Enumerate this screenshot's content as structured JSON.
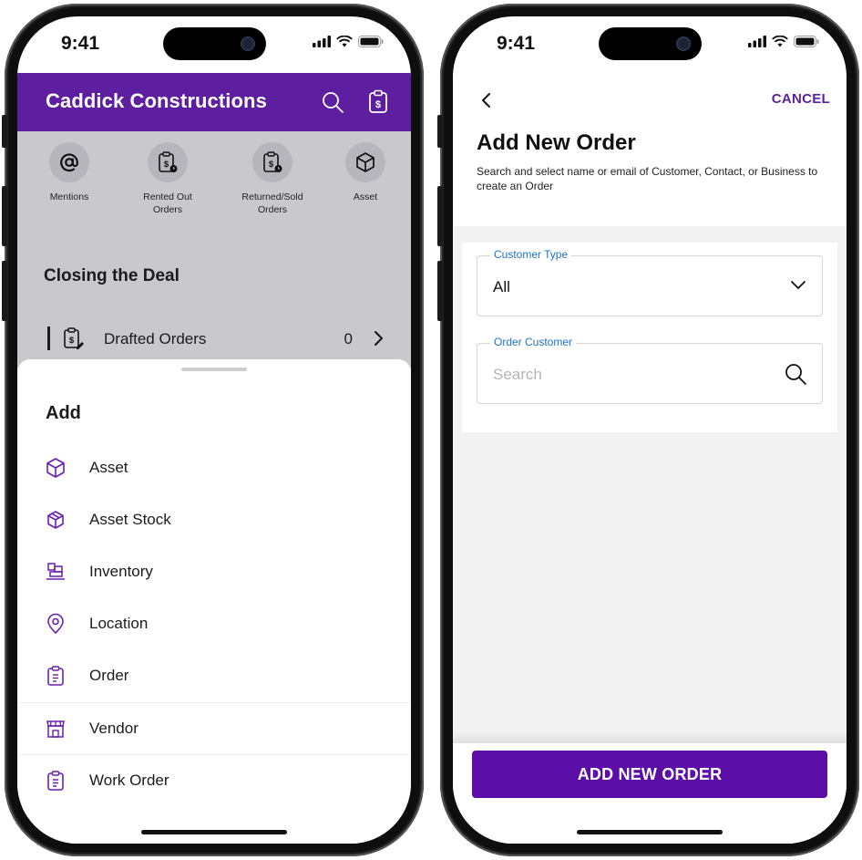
{
  "left": {
    "status": {
      "time": "9:41"
    },
    "header": {
      "title": "Caddick Constructions",
      "search_icon": "search-icon",
      "order_icon": "clipboard-dollar-icon",
      "bg_color": "#5e1ea0"
    },
    "shortcuts": [
      {
        "label_line1": "Mentions",
        "label_line2": "",
        "icon": "at-sign-icon"
      },
      {
        "label_line1": "Rented Out",
        "label_line2": "Orders",
        "icon": "clipboard-dollar-clock-icon"
      },
      {
        "label_line1": "Returned/Sold",
        "label_line2": "Orders",
        "icon": "clipboard-dollar-clock-icon"
      },
      {
        "label_line1": "Asset",
        "label_line2": "",
        "icon": "cube-icon"
      }
    ],
    "section_title": "Closing the Deal",
    "drafted": {
      "label": "Drafted Orders",
      "count": "0"
    },
    "sheet": {
      "title": "Add",
      "items": [
        {
          "label": "Asset",
          "icon": "cube-icon"
        },
        {
          "label": "Asset Stock",
          "icon": "cube-stack-icon"
        },
        {
          "label": "Inventory",
          "icon": "inventory-icon"
        },
        {
          "label": "Location",
          "icon": "location-pin-icon"
        },
        {
          "label": "Order",
          "icon": "clipboard-icon"
        },
        {
          "label": "Vendor",
          "icon": "storefront-icon"
        },
        {
          "label": "Work Order",
          "icon": "clipboard-icon"
        }
      ]
    }
  },
  "right": {
    "status": {
      "time": "9:41"
    },
    "nav": {
      "cancel_label": "CANCEL"
    },
    "title": "Add New Order",
    "subtitle": "Search and select name or email of Customer,  Contact, or Business to create an Order",
    "customer_type": {
      "label": "Customer Type",
      "value": "All"
    },
    "order_customer": {
      "label": "Order Customer",
      "placeholder": "Search"
    },
    "primary_button": "ADD NEW ORDER",
    "accent_color": "#5b0fa8",
    "label_color": "#1f74c7"
  }
}
